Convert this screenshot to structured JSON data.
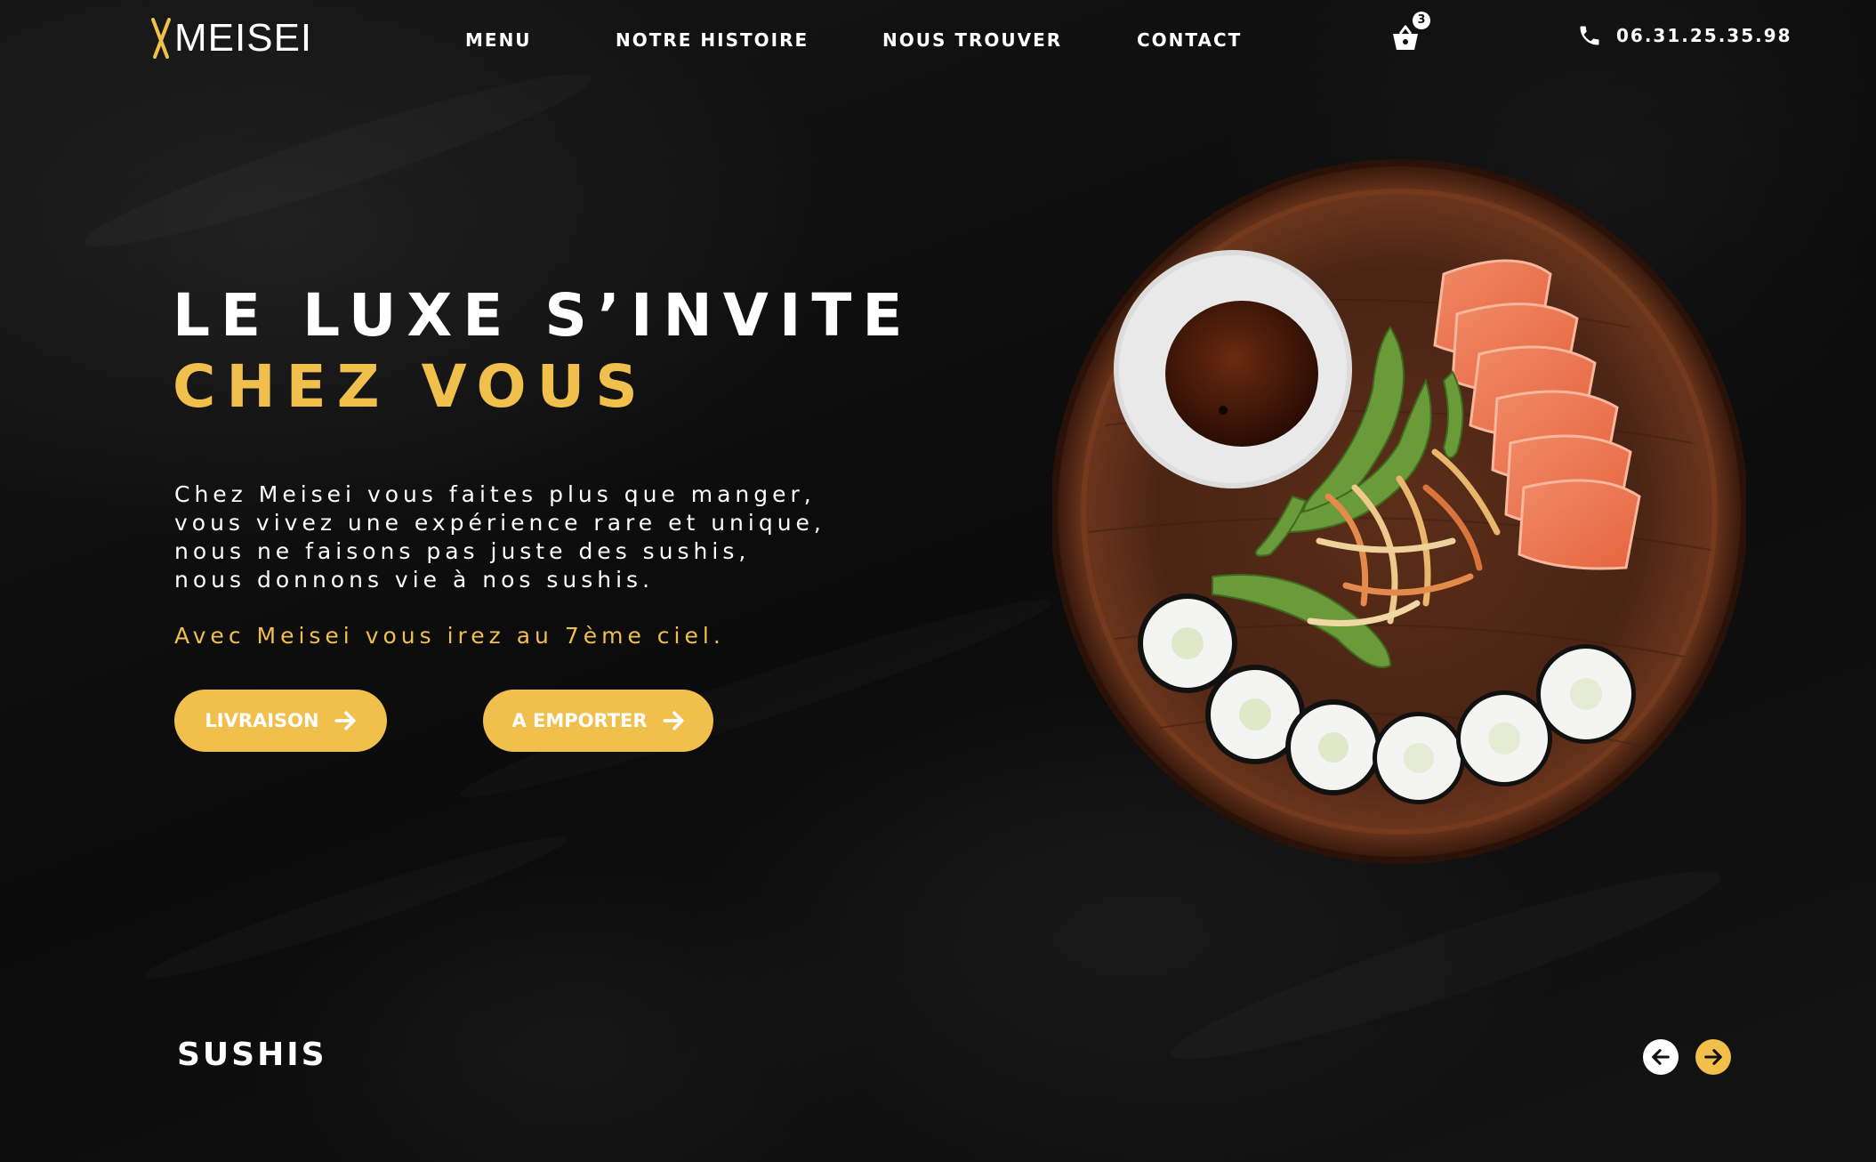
{
  "brand": {
    "name": "MEISEI",
    "accent_color": "#f0bf4c"
  },
  "nav": {
    "links": [
      "MENU",
      "NOTRE HISTOIRE",
      "NOUS TROUVER",
      "CONTACT"
    ],
    "cart_icon": "basket-icon",
    "cart_count": "3",
    "phone_icon": "phone-icon",
    "phone": "06.31.25.35.98"
  },
  "hero": {
    "title_line1": "LE LUXE S’INVITE",
    "title_line2": "CHEZ VOUS",
    "body": "Chez Meisei vous faites plus que manger, vous vivez une expérience rare et unique, nous ne faisons pas juste des sushis, nous donnons vie à nos sushis.",
    "highlight": "Avec Meisei vous irez au 7ème ciel.",
    "buttons": [
      {
        "label": "LIVRAISON",
        "icon": "arrow-right-icon"
      },
      {
        "label": "A EMPORTER",
        "icon": "arrow-right-icon"
      }
    ]
  },
  "section": {
    "title": "SUSHIS",
    "prev_icon": "arrow-left-icon",
    "next_icon": "arrow-right-icon"
  }
}
